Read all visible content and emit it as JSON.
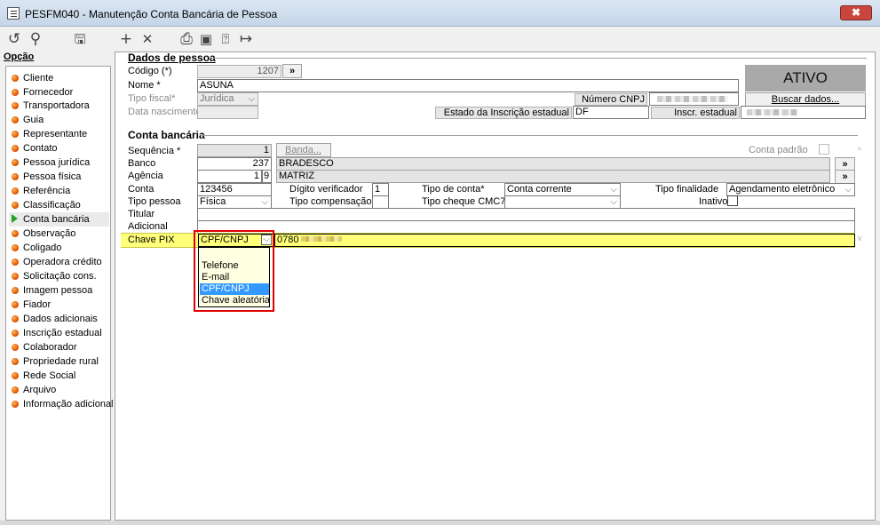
{
  "window": {
    "title": "PESFM040 - Manutenção Conta Bancária de Pessoa",
    "close_glyph": "✖"
  },
  "toolbar": {
    "undo": "↺",
    "search": "⚲",
    "save": "🖫",
    "add": "+",
    "remove": "✕",
    "print": "⎙",
    "calendar": "▣",
    "help": "⍰",
    "exit": "↦"
  },
  "sidebar": {
    "heading": "Opção",
    "items": [
      {
        "label": "Cliente"
      },
      {
        "label": "Fornecedor"
      },
      {
        "label": "Transportadora"
      },
      {
        "label": "Guia"
      },
      {
        "label": "Representante"
      },
      {
        "label": "Contato"
      },
      {
        "label": "Pessoa jurídica"
      },
      {
        "label": "Pessoa física"
      },
      {
        "label": "Referência"
      },
      {
        "label": "Classificação"
      },
      {
        "label": "Conta bancária"
      },
      {
        "label": "Observação"
      },
      {
        "label": "Coligado"
      },
      {
        "label": "Operadora crédito"
      },
      {
        "label": "Solicitação cons."
      },
      {
        "label": "Imagem pessoa"
      },
      {
        "label": "Fiador"
      },
      {
        "label": "Dados adicionais"
      },
      {
        "label": "Inscrição estadual"
      },
      {
        "label": "Colaborador"
      },
      {
        "label": "Propriedade rural"
      },
      {
        "label": "Rede Social"
      },
      {
        "label": "Arquivo"
      },
      {
        "label": "Informação adicional"
      }
    ],
    "selected": "Conta bancária"
  },
  "dados_pessoa": {
    "heading": "Dados de pessoa",
    "codigo_label": "Código (*)",
    "codigo_value": "1207",
    "codigo_btn": "»",
    "nome_label": "Nome *",
    "nome_value": "ASUNA",
    "tipo_fiscal_label": "Tipo fiscal*",
    "tipo_fiscal_value": "Jurídica",
    "data_nasc_label": "Data nascimento",
    "cnpj_label": "Número CNPJ",
    "estado_label": "Estado da Inscrição estadual",
    "estado_value": "DF",
    "inscr_label": "Inscr. estadual",
    "status": "ATIVO",
    "buscar_label": "Buscar dados..."
  },
  "conta_bancaria": {
    "heading": "Conta bancária",
    "sequencia_label": "Sequência *",
    "sequencia_value": "1",
    "banda_label": "Banda...",
    "conta_padrao_label": "Conta padrão",
    "banco_label": "Banco",
    "banco_value": "237",
    "banco_nome": "BRADESCO",
    "agencia_label": "Agência",
    "agencia_value": "1",
    "agencia_dv": "9",
    "agencia_nome": "MATRIZ",
    "more_glyph": "»",
    "conta_label": "Conta",
    "conta_value": "123456",
    "digito_label": "Dígito verificador",
    "digito_value": "1",
    "tipo_conta_label": "Tipo de conta*",
    "tipo_conta_value": "Conta corrente",
    "tipo_finalidade_label": "Tipo finalidade",
    "tipo_finalidade_value": "Agendamento eletrônico",
    "tipo_pessoa_label": "Tipo pessoa",
    "tipo_pessoa_value": "Física",
    "tipo_comp_label": "Tipo compensação",
    "tipo_cheque_label": "Tipo cheque CMC7",
    "inativo_label": "Inativo",
    "titular_label": "Titular",
    "adicional_label": "Adicional",
    "chave_pix_label": "Chave PIX",
    "chave_pix_type": "CPF/CNPJ",
    "chave_pix_value": "0780",
    "pix_options": [
      "",
      "Telefone",
      "E-mail",
      "CPF/CNPJ",
      "Chave aleatória"
    ],
    "pix_highlighted": "CPF/CNPJ"
  },
  "icons": {
    "caret": "⌵",
    "scroll_up": "^",
    "scroll_down": "v"
  }
}
